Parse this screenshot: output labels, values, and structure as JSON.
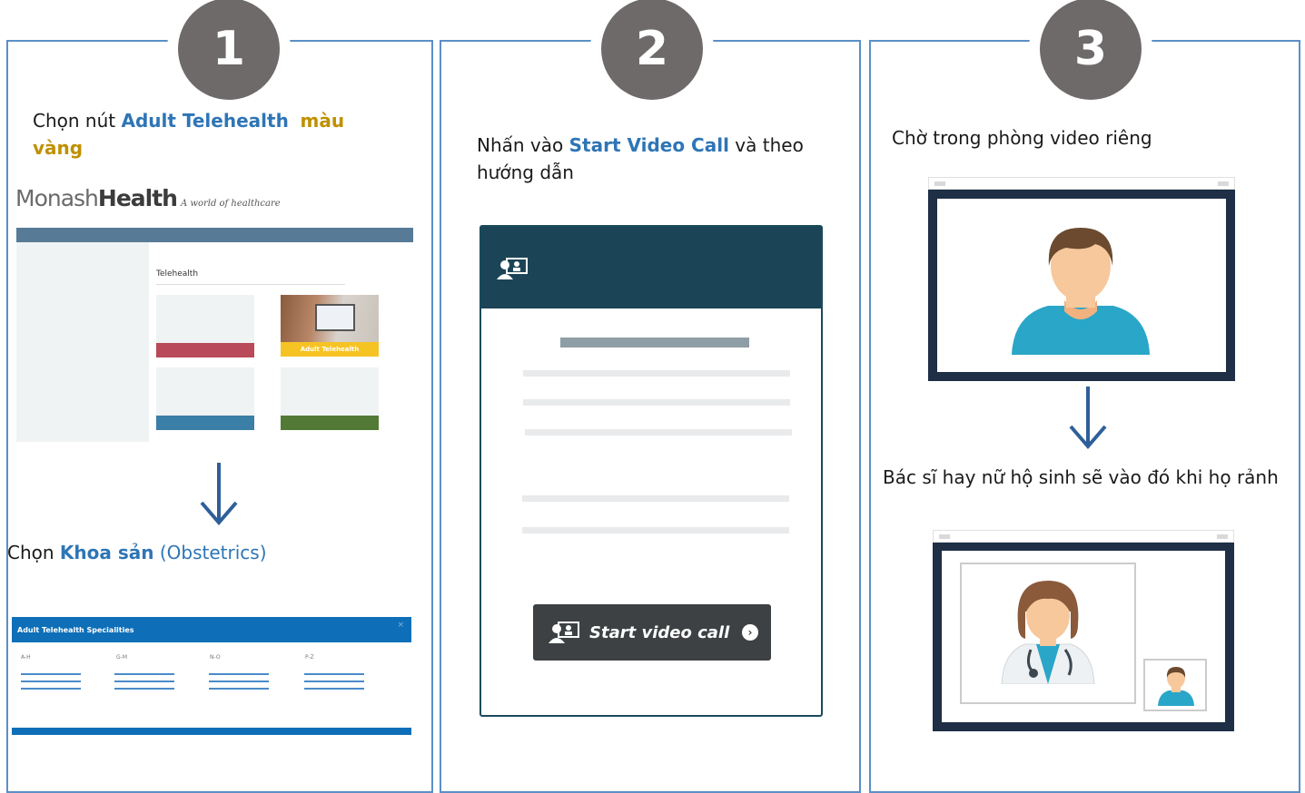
{
  "steps": {
    "one": {
      "number": "1",
      "text_prefix": "Chọn nút ",
      "text_highlight_blue": "Adult Telehealth",
      "text_highlight_gold": "màu vàng",
      "logo_light": "Monash",
      "logo_bold": "Health",
      "logo_tagline": "A world of healthcare",
      "mockup_title": "Telehealth",
      "adult_button_label": "Adult Telehealth",
      "sub_text_prefix": "Chọn ",
      "sub_text_highlight": "Khoa sản",
      "sub_text_suffix": " (Obstetrics)",
      "specialities_title": "Adult Telehealth Specialities",
      "specialities_close": "×",
      "specialities_columns": [
        "A-H",
        "G-M",
        "N-O",
        "P-Z"
      ]
    },
    "two": {
      "number": "2",
      "text_prefix": "Nhấn vào ",
      "text_highlight_blue": "Start Video Call",
      "text_suffix": " và theo hướng dẫn",
      "button_label": "Start video call",
      "button_chevron": "›"
    },
    "three": {
      "number": "3",
      "text": "Chờ trong phòng video riêng",
      "sub_text": "Bác sĩ hay nữ hộ sinh sẽ vào đó khi họ rảnh"
    }
  },
  "colors": {
    "panel_border": "#5b8fc7",
    "step_circle": "#6e6a6a",
    "highlight_blue": "#2e75b6",
    "highlight_gold": "#bf9000",
    "arrow": "#2e5f99",
    "card_header": "#1b4556",
    "window_frame": "#1e2f46",
    "person_shirt": "#2aa6c8",
    "person_hair": "#6b4a2f",
    "person_skin": "#f7c89b"
  },
  "icons": [
    "video-call-icon",
    "chevron-right-icon",
    "down-arrow-icon",
    "person-icon",
    "doctor-icon"
  ]
}
